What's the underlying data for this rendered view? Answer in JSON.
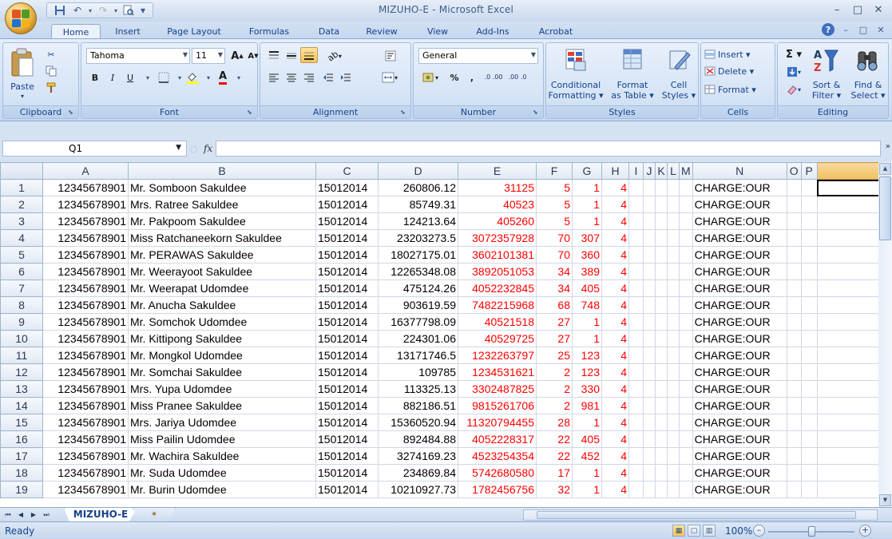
{
  "window": {
    "title": "MIZUHO-E - Microsoft Excel",
    "minimize": "–",
    "maximize": "□",
    "close": "✕"
  },
  "qat": {
    "save": "💾",
    "undo": "↶",
    "redo": "↷",
    "print_preview": "🔍",
    "customize": "▾"
  },
  "tabs": [
    "Home",
    "Insert",
    "Page Layout",
    "Formulas",
    "Data",
    "Review",
    "View",
    "Add-Ins",
    "Acrobat"
  ],
  "ribbon_right": {
    "help": "?",
    "min": "–",
    "restore": "□",
    "close": "✕"
  },
  "ribbon": {
    "clipboard": {
      "label": "Clipboard",
      "paste": "Paste"
    },
    "font": {
      "label": "Font",
      "name": "Tahoma",
      "size": "11",
      "bold": "B",
      "italic": "I",
      "underline": "U",
      "grow": "A",
      "shrink": "A"
    },
    "alignment": {
      "label": "Alignment"
    },
    "number": {
      "label": "Number",
      "format": "General",
      "percent": "%",
      "comma": ",",
      "inc_decimal": ".0 .00",
      "dec_decimal": ".00 .0"
    },
    "styles": {
      "label": "Styles",
      "conditional": "Conditional",
      "conditional2": "Formatting ▾",
      "format_table": "Format",
      "format_table2": "as Table ▾",
      "cell_styles": "Cell",
      "cell_styles2": "Styles ▾"
    },
    "cells": {
      "label": "Cells",
      "insert": "Insert ▾",
      "delete": "Delete ▾",
      "format": "Format ▾"
    },
    "editing": {
      "label": "Editing",
      "sigma": "Σ ▾",
      "sort": "Sort &",
      "sort2": "Filter ▾",
      "find": "Find &",
      "find2": "Select ▾"
    }
  },
  "formula_bar": {
    "name_box": "Q1",
    "fx": "fx",
    "value": ""
  },
  "sheet": {
    "columns": [
      "A",
      "B",
      "C",
      "D",
      "E",
      "F",
      "G",
      "H",
      "I",
      "J",
      "K",
      "L",
      "M",
      "N",
      "O",
      "P"
    ],
    "rows": [
      {
        "n": "1",
        "a": "12345678901",
        "b": "Mr. Somboon Sakuldee",
        "c": "15012014",
        "d": "260806.12",
        "e": "31125",
        "f": "5",
        "g": "1",
        "h": "4",
        "n_col": "CHARGE:OUR"
      },
      {
        "n": "2",
        "a": "12345678901",
        "b": "Mrs. Ratree Sakuldee",
        "c": "15012014",
        "d": "85749.31",
        "e": "40523",
        "f": "5",
        "g": "1",
        "h": "4",
        "n_col": "CHARGE:OUR"
      },
      {
        "n": "3",
        "a": "12345678901",
        "b": "Mr. Pakpoom Sakuldee",
        "c": "15012014",
        "d": "124213.64",
        "e": "405260",
        "f": "5",
        "g": "1",
        "h": "4",
        "n_col": "CHARGE:OUR"
      },
      {
        "n": "4",
        "a": "12345678901",
        "b": "Miss Ratchaneekorn Sakuldee",
        "c": "15012014",
        "d": "23203273.5",
        "e": "3072357928",
        "f": "70",
        "g": "307",
        "h": "4",
        "n_col": "CHARGE:OUR"
      },
      {
        "n": "5",
        "a": "12345678901",
        "b": "Mr. PERAWAS Sakuldee",
        "c": "15012014",
        "d": "18027175.01",
        "e": "3602101381",
        "f": "70",
        "g": "360",
        "h": "4",
        "n_col": "CHARGE:OUR"
      },
      {
        "n": "6",
        "a": "12345678901",
        "b": "Mr. Weerayoot Sakuldee",
        "c": "15012014",
        "d": "12265348.08",
        "e": "3892051053",
        "f": "34",
        "g": "389",
        "h": "4",
        "n_col": "CHARGE:OUR"
      },
      {
        "n": "7",
        "a": "12345678901",
        "b": "Mr. Weerapat Udomdee",
        "c": "15012014",
        "d": "475124.26",
        "e": "4052232845",
        "f": "34",
        "g": "405",
        "h": "4",
        "n_col": "CHARGE:OUR"
      },
      {
        "n": "8",
        "a": "12345678901",
        "b": "Mr. Anucha Sakuldee",
        "c": "15012014",
        "d": "903619.59",
        "e": "7482215968",
        "f": "68",
        "g": "748",
        "h": "4",
        "n_col": "CHARGE:OUR"
      },
      {
        "n": "9",
        "a": "12345678901",
        "b": "Mr. Somchok Udomdee",
        "c": "15012014",
        "d": "16377798.09",
        "e": "40521518",
        "f": "27",
        "g": "1",
        "h": "4",
        "n_col": "CHARGE:OUR"
      },
      {
        "n": "10",
        "a": "12345678901",
        "b": "Mr. Kittipong Sakuldee",
        "c": "15012014",
        "d": "224301.06",
        "e": "40529725",
        "f": "27",
        "g": "1",
        "h": "4",
        "n_col": "CHARGE:OUR"
      },
      {
        "n": "11",
        "a": "12345678901",
        "b": "Mr. Mongkol Udomdee",
        "c": "15012014",
        "d": "13171746.5",
        "e": "1232263797",
        "f": "25",
        "g": "123",
        "h": "4",
        "n_col": "CHARGE:OUR"
      },
      {
        "n": "12",
        "a": "12345678901",
        "b": "Mr. Somchai Sakuldee",
        "c": "15012014",
        "d": "109785",
        "e": "1234531621",
        "f": "2",
        "g": "123",
        "h": "4",
        "n_col": "CHARGE:OUR"
      },
      {
        "n": "13",
        "a": "12345678901",
        "b": "Mrs. Yupa Udomdee",
        "c": "15012014",
        "d": "113325.13",
        "e": "3302487825",
        "f": "2",
        "g": "330",
        "h": "4",
        "n_col": "CHARGE:OUR"
      },
      {
        "n": "14",
        "a": "12345678901",
        "b": "Miss Pranee Sakuldee",
        "c": "15012014",
        "d": "882186.51",
        "e": "9815261706",
        "f": "2",
        "g": "981",
        "h": "4",
        "n_col": "CHARGE:OUR"
      },
      {
        "n": "15",
        "a": "12345678901",
        "b": "Mrs. Jariya Udomdee",
        "c": "15012014",
        "d": "15360520.94",
        "e": "11320794455",
        "f": "28",
        "g": "1",
        "h": "4",
        "n_col": "CHARGE:OUR"
      },
      {
        "n": "16",
        "a": "12345678901",
        "b": "Miss Pailin Udomdee",
        "c": "15012014",
        "d": "892484.88",
        "e": "4052228317",
        "f": "22",
        "g": "405",
        "h": "4",
        "n_col": "CHARGE:OUR"
      },
      {
        "n": "17",
        "a": "12345678901",
        "b": "Mr. Wachira Sakuldee",
        "c": "15012014",
        "d": "3274169.23",
        "e": "4523254354",
        "f": "22",
        "g": "452",
        "h": "4",
        "n_col": "CHARGE:OUR"
      },
      {
        "n": "18",
        "a": "12345678901",
        "b": "Mr. Suda Udomdee",
        "c": "15012014",
        "d": "234869.84",
        "e": "5742680580",
        "f": "17",
        "g": "1",
        "h": "4",
        "n_col": "CHARGE:OUR"
      },
      {
        "n": "19",
        "a": "12345678901",
        "b": "Mr. Burin Udomdee",
        "c": "15012014",
        "d": "10210927.73",
        "e": "1782456756",
        "f": "32",
        "g": "1",
        "h": "4",
        "n_col": "CHARGE:OUR"
      }
    ]
  },
  "sheet_tabs": {
    "active": "MIZUHO-E"
  },
  "status": {
    "text": "Ready",
    "zoom": "100%",
    "zoom_minus": "–",
    "zoom_plus": "+"
  },
  "colors": {
    "accent": "#15428b",
    "red_values": "#ff0000"
  }
}
